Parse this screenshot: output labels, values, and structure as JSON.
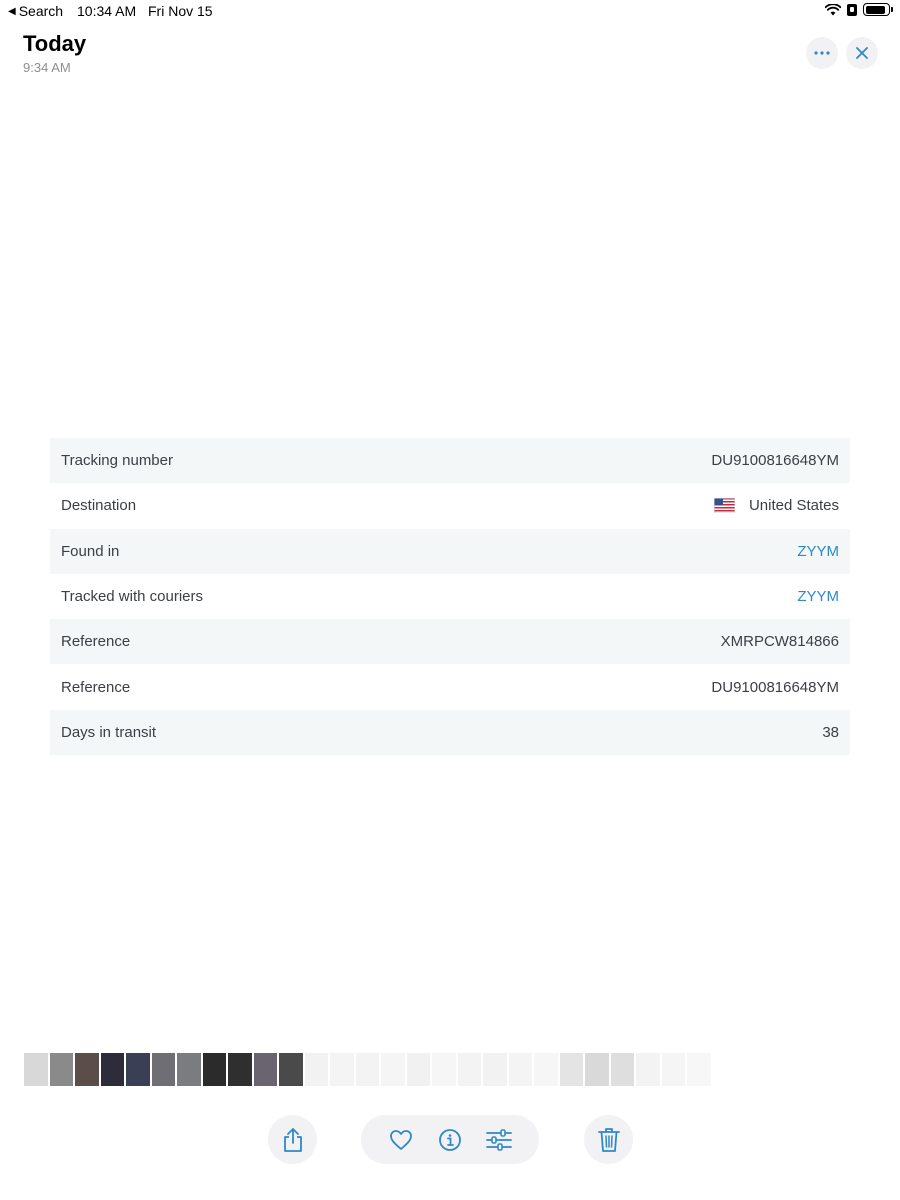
{
  "status_bar": {
    "back_label": "Search",
    "time": "10:34 AM",
    "date": "Fri Nov 15",
    "battery_level": 0.9
  },
  "header": {
    "title": "Today",
    "subtitle": "9:34 AM",
    "more_icon": "ellipsis-icon",
    "close_icon": "close-icon"
  },
  "details": {
    "rows": [
      {
        "label": "Tracking number",
        "value": "DU9100816648YM"
      },
      {
        "label": "Destination",
        "value": "United States",
        "flag_icon": "us-flag-icon"
      },
      {
        "label": "Found in",
        "value": "ZYYM"
      },
      {
        "label": "Tracked with couriers",
        "value": "ZYYM"
      },
      {
        "label": "Reference",
        "value": "XMRPCW814866"
      },
      {
        "label": "Reference",
        "value": "DU9100816648YM"
      },
      {
        "label": "Days in transit",
        "value": "38"
      }
    ]
  },
  "toolbar": {
    "share_icon": "share-icon",
    "favorite_icon": "heart-icon",
    "info_icon": "info-icon",
    "adjust_icon": "sliders-icon",
    "delete_icon": "trash-icon"
  },
  "colors": {
    "accent": "#2f88c9",
    "row_shade": "#f4f7f8",
    "button_bg": "#f2f2f5"
  }
}
